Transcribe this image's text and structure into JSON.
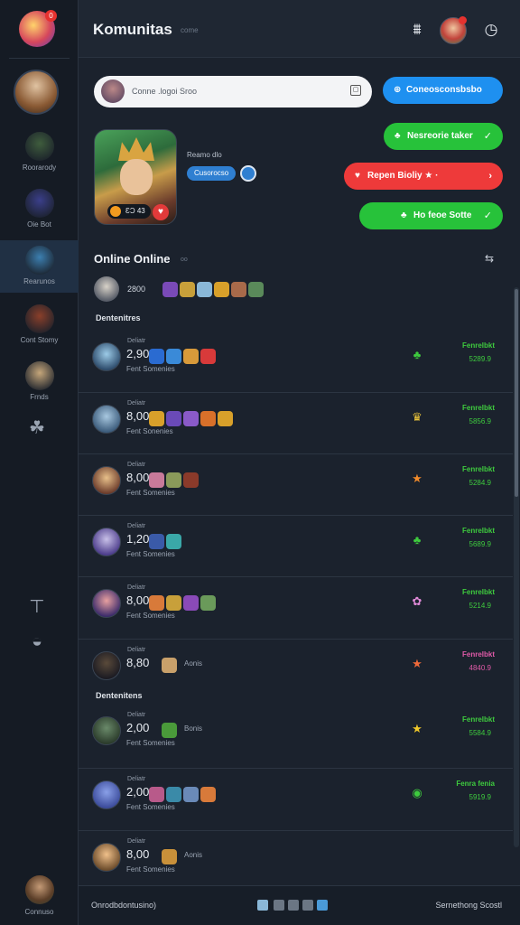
{
  "sidebar": {
    "items": [
      {
        "label": "Roorarody",
        "color": "#3f5d3d"
      },
      {
        "label": "Oie Bot",
        "color": "#3b3f8a"
      },
      {
        "label": "Rearunos",
        "color": "#3c7fb0",
        "active": true
      },
      {
        "label": "Cont Stomy",
        "color": "#8a3f2a"
      },
      {
        "label": "Frnds",
        "color": "#c5a67a"
      }
    ],
    "bottom_label": "Connuso"
  },
  "header": {
    "title": "Komunitas",
    "subtitle": "come"
  },
  "search": {
    "placeholder": "Conne .logoi Sroo"
  },
  "buttons": {
    "connect": "Coneosconsbsbo",
    "green1": "Nesreorie taker",
    "red": "Repen Bioliy",
    "green2": "Ho feoe Sotte"
  },
  "profile": {
    "name": "Reamo dlo",
    "chip": "Cusorocso",
    "badge": "ƐƆ 43"
  },
  "online": {
    "title": "Online Online",
    "sub": "oo",
    "count": "2800"
  },
  "groups": [
    "Dentenitres",
    "Dentenitens"
  ],
  "list": [
    {
      "tag": "Deliatr",
      "num": "2,90",
      "meta": "Fent Somenies",
      "word": "",
      "rt": "Fenrelbkt",
      "rv": "5289.9",
      "rtColor": "#3ecb3e",
      "ricon": "♣",
      "riconColor": "#3ecb3e",
      "av": [
        "#9ccbe8",
        "#2c4a6a"
      ],
      "icons": [
        "#2a6bd1",
        "#3a8ad8",
        "#d89a3a",
        "#d83a3a"
      ]
    },
    {
      "tag": "Deliatr",
      "num": "8,00",
      "meta": "Fent Sonenies",
      "word": "",
      "rt": "Fenrelbkt",
      "rv": "5856.9",
      "rtColor": "#3ecb3e",
      "ricon": "♛",
      "riconColor": "#e8c23a",
      "av": [
        "#a8c8e0",
        "#3a5a7a"
      ],
      "icons": [
        "#d8a02a",
        "#6a4ab8",
        "#8a5ac8",
        "#d8702a",
        "#d8a02a"
      ]
    },
    {
      "tag": "Deliatr",
      "num": "8,00",
      "meta": "Fent Somenies",
      "word": "",
      "rt": "Fenrelbkt",
      "rv": "5284.9",
      "rtColor": "#3ecb3e",
      "ricon": "★",
      "riconColor": "#f08a2a",
      "av": [
        "#e8c08a",
        "#6a3a2a"
      ],
      "icons": [
        "#c87a9a",
        "#8a9a5a",
        "#8a3a2a"
      ]
    },
    {
      "tag": "Deliatr",
      "num": "1,20",
      "meta": "Fent Somenies",
      "word": "",
      "rt": "Fenrelbkt",
      "rv": "5689.9",
      "rtColor": "#3ecb3e",
      "ricon": "♣",
      "riconColor": "#3ecb3e",
      "av": [
        "#c8c0e8",
        "#4a3a8a"
      ],
      "icons": [
        "#3a5aa8",
        "#3aa8a8"
      ]
    },
    {
      "tag": "Deliatr",
      "num": "8,00",
      "meta": "Fent Somenies",
      "word": "",
      "rt": "Fenrelbkt",
      "rv": "5214.9",
      "rtColor": "#3ecb3e",
      "ricon": "✿",
      "riconColor": "#e08ad8",
      "av": [
        "#e8a0a0",
        "#3a2a6a"
      ],
      "icons": [
        "#d87a3a",
        "#c8a03a",
        "#8a4ab8",
        "#6a9a5a"
      ]
    },
    {
      "tag": "Deliatr",
      "num": "8,80",
      "meta": "",
      "word": "Aonis",
      "rt": "Fenrelbkt",
      "rv": "4840.9",
      "rtColor": "#e05aa8",
      "ricon": "★",
      "riconColor": "#f06a3a",
      "av": [
        "#5a4a3a",
        "#1a1a22"
      ],
      "icons": [
        "#c8a06a"
      ]
    },
    {
      "tag": "Deliatr",
      "num": "2,00",
      "meta": "Fent Somenies",
      "word": "Bonis",
      "rt": "Fenrelbkt",
      "rv": "5584.9",
      "rtColor": "#3ecb3e",
      "ricon": "★",
      "riconColor": "#f0c82a",
      "av": [
        "#6a8a6a",
        "#2a3a2a"
      ],
      "icons": [
        "#4a9a3a"
      ]
    },
    {
      "tag": "Deliatr",
      "num": "2,00",
      "meta": "Fent Somenies",
      "word": "",
      "rt": "Fenra fenia",
      "rv": "5919.9",
      "rtColor": "#3ecb3e",
      "ricon": "◉",
      "riconColor": "#3ecb3e",
      "av": [
        "#8aa0e8",
        "#3a4a9a"
      ],
      "icons": [
        "#b85a8a",
        "#3a8aa8",
        "#6a8ab8",
        "#d87a3a"
      ]
    },
    {
      "tag": "Deliatr",
      "num": "8,00",
      "meta": "Fent Somenies",
      "word": "Aonis",
      "rt": "",
      "rv": "",
      "rtColor": "#3ecb3e",
      "ricon": "",
      "riconColor": "#8a93a0",
      "av": [
        "#f0c08a",
        "#6a4a2a"
      ],
      "icons": [
        "#c8903a"
      ]
    }
  ],
  "footer": {
    "left": "Onrodbdontusino)",
    "right": "Sernethong Scostl"
  }
}
